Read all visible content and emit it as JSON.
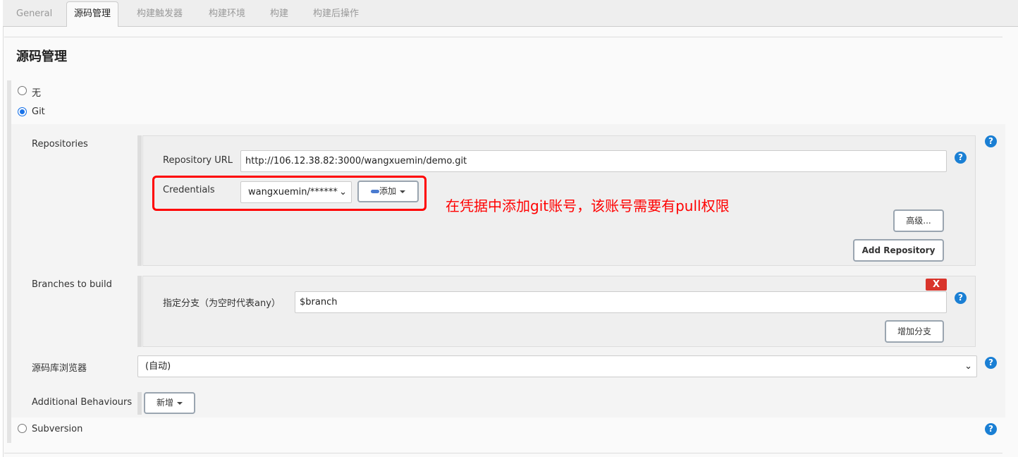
{
  "tabs": [
    "General",
    "源码管理",
    "构建触发器",
    "构建环境",
    "构建",
    "构建后操作"
  ],
  "section_title": "源码管理",
  "scm_options": {
    "none": "无",
    "git": "Git",
    "svn": "Subversion"
  },
  "git": {
    "repositories_label": "Repositories",
    "repo_url_label": "Repository URL",
    "repo_url": "http://106.12.38.82:3000/wangxuemin/demo.git",
    "credentials_label": "Credentials",
    "credentials_value": "wangxuemin/******",
    "add_button": "添加",
    "advanced_button": "高级...",
    "add_repository_button": "Add Repository",
    "branches_label": "Branches to build",
    "branch_spec_label": "指定分支（为空时代表any）",
    "branch_value": "$branch",
    "delete_button": "X",
    "add_branch_button": "增加分支",
    "browser_label": "源码库浏览器",
    "browser_value": "(自动)",
    "behaviours_label": "Additional Behaviours",
    "new_button": "新增"
  },
  "annotation": "在凭据中添加git账号，该账号需要有pull权限",
  "colors": {
    "annotation": "#ff0000",
    "help": "#1a7fd4",
    "delete": "#d9342b"
  }
}
